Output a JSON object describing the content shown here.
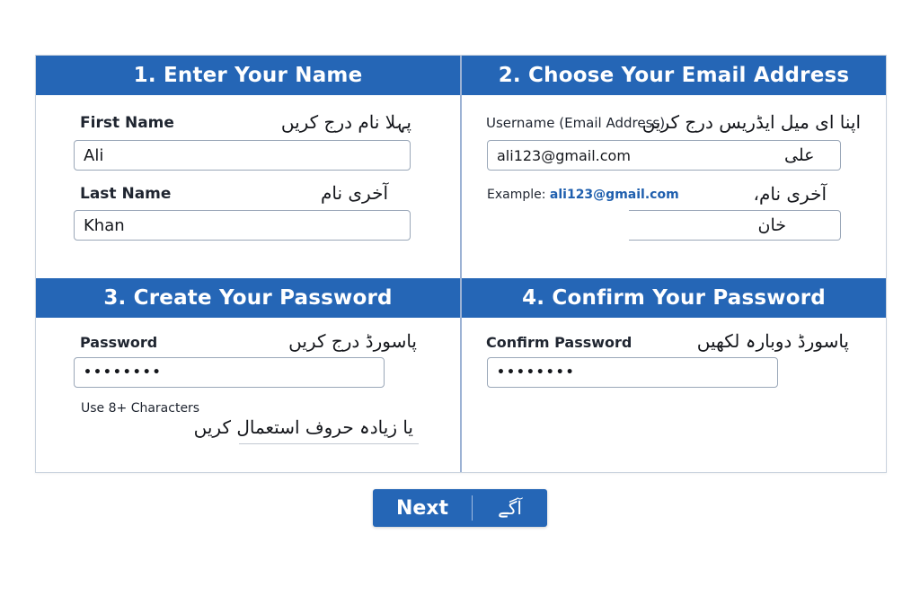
{
  "sections": {
    "name": {
      "title": "1. Enter Your Name",
      "first_label": "First Name",
      "first_urdu": "پہلا نام درج کریں",
      "first_value": "Ali",
      "last_label": "Last Name",
      "last_urdu": "آخری نام",
      "last_value": "Khan"
    },
    "email": {
      "title": "2. Choose Your Email Address",
      "username_label": "Username (Email Address)",
      "username_urdu": "اپنا ای میل ایڈریس درج کریں",
      "username_value": "ali123@gmail.com",
      "username_urdu_value": "علی",
      "example_prefix": "Example: ",
      "example_email": "ali123@gmail.com",
      "example_urdu": "آخری نام،",
      "second_field_urdu": "خان"
    },
    "password": {
      "title": "3. Create Your Password",
      "label": "Password",
      "urdu": "پاسورڈ درج کریں",
      "value": "••••••••",
      "hint": "Use 8+ Characters",
      "hint_urdu": "یا زیادہ حروف استعمال کریں"
    },
    "confirm": {
      "title": "4. Confirm Your Password",
      "label": "Confirm Password",
      "urdu": "پاسورڈ دوبارہ لکھیں",
      "value": "••••••••"
    }
  },
  "next_button": {
    "label": "Next",
    "urdu": "آگے"
  },
  "colors": {
    "header": "#2566b6",
    "link": "#1f5fae"
  }
}
